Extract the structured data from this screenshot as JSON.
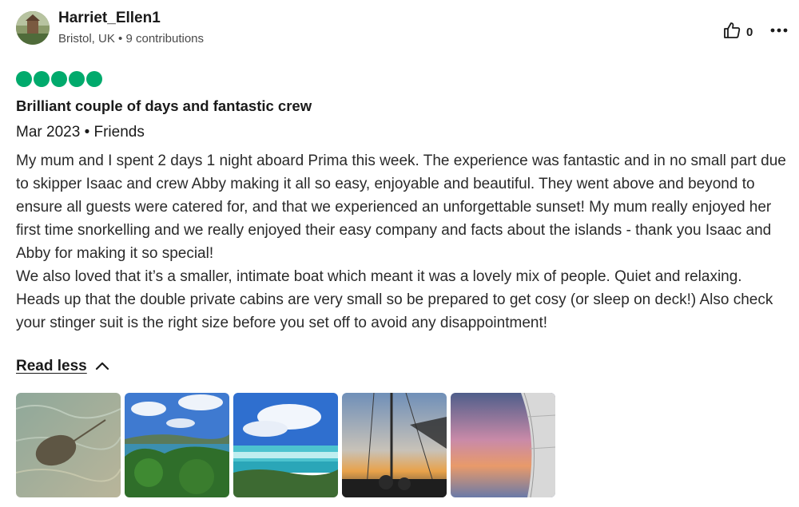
{
  "reviewer": {
    "name": "Harriet_Ellen1",
    "location": "Bristol, UK",
    "separator": "•",
    "contributions": "9 contributions"
  },
  "helpful": {
    "icon": "thumbs-up-icon",
    "count": "0"
  },
  "more_icon": "more-options-icon",
  "rating": {
    "value": 5,
    "max": 5,
    "color": "#00aa6c"
  },
  "review": {
    "title": "Brilliant couple of days and fantastic crew",
    "date": "Mar 2023",
    "separator": "•",
    "trip_type": "Friends",
    "paragraphs": [
      "My mum and I spent 2 days 1 night aboard Prima this week. The experience was fantastic and in no small part due to skipper Isaac and crew Abby making it all so easy, enjoyable and beautiful. They went above and beyond to ensure all guests were catered for, and that we experienced an unforgettable sunset! My mum really enjoyed her first time snorkelling and we really enjoyed their easy company and facts about the islands - thank you Isaac and Abby for making it so special!",
      "We also loved that it’s a smaller, intimate boat which meant it was a lovely mix of people. Quiet and relaxing.",
      "Heads up that the double private cabins are very small so be prepared to get cosy (or sleep on deck!) Also check your stinger suit is the right size before you set off to avoid any disappointment!"
    ],
    "read_less_label": "Read less"
  },
  "photos": [
    {
      "name": "photo-stingray"
    },
    {
      "name": "photo-bay-view"
    },
    {
      "name": "photo-beach-lagoon"
    },
    {
      "name": "photo-sailing-sunset"
    },
    {
      "name": "photo-sail-dusk"
    }
  ]
}
